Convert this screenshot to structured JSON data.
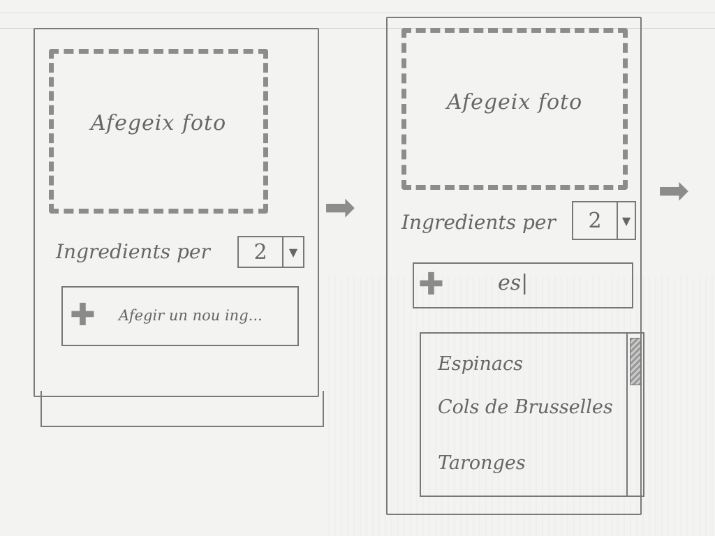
{
  "screens": [
    {
      "photo_label": "Afegeix foto",
      "ingredients_label": "Ingredients per",
      "servings_value": "2",
      "add_field_text": "Afegir un nou ing...",
      "dropdown_open": false
    },
    {
      "photo_label": "Afegeix foto",
      "ingredients_label": "Ingredients per",
      "servings_value": "2",
      "add_field_text": "es|",
      "dropdown_open": true,
      "dropdown_items": [
        "Espinacs",
        "Cols de Brusselles",
        "Taronges"
      ]
    }
  ],
  "icons": {
    "plus": "plus-icon",
    "select_arrow": "triangle-down-icon",
    "flow_arrow": "arrow-right-icon"
  }
}
